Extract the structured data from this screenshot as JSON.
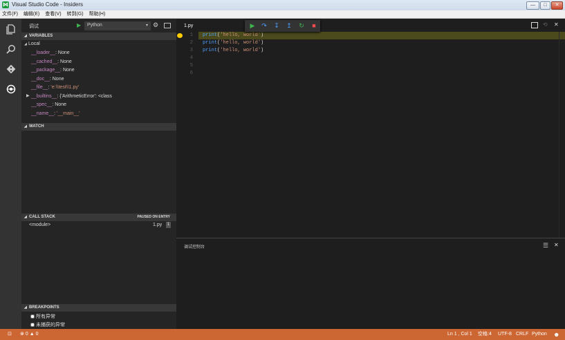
{
  "window": {
    "title": "Visual Studio Code - Insiders",
    "minimize": "—",
    "maximize": "□",
    "close": "✕"
  },
  "menu": [
    "文件(F)",
    "编辑(E)",
    "查看(V)",
    "转到(G)",
    "帮助(H)"
  ],
  "debug": {
    "label": "调试",
    "config": "Python"
  },
  "variables": {
    "header": "VARIABLES",
    "scope": "Local",
    "items": [
      {
        "name": "__loader__",
        "sep": ": ",
        "value": "None"
      },
      {
        "name": "__cached__",
        "sep": ": ",
        "value": "None"
      },
      {
        "name": "__package__",
        "sep": ": ",
        "value": "None"
      },
      {
        "name": "__doc__",
        "sep": ": ",
        "value": "None"
      },
      {
        "name": "__file__",
        "sep": ": ",
        "value": "'e:\\\\test\\\\1.py'"
      },
      {
        "name": "__builtins__",
        "sep": ": ",
        "value": "{'ArithmeticError': <class"
      },
      {
        "name": "__spec__",
        "sep": ": ",
        "value": "None"
      },
      {
        "name": "__name__",
        "sep": ": ",
        "value": "'__main__'"
      }
    ]
  },
  "watch": {
    "header": "WATCH"
  },
  "callstack": {
    "header": "CALL STACK",
    "status": "PAUSED ON ENTRY",
    "frame": "<module>",
    "file": "1.py",
    "line": "1"
  },
  "breakpoints": {
    "header": "BREAKPOINTS",
    "items": [
      "所有异常",
      "未捕获的异常"
    ]
  },
  "editor": {
    "tab": "1.py",
    "line_numbers": [
      "1",
      "2",
      "3",
      "4",
      "5",
      "6"
    ],
    "lines": [
      {
        "fn": "print",
        "open": "(",
        "str": "'hello, world'",
        "close": ")"
      },
      {
        "fn": "print",
        "open": "(",
        "str": "'hello, world'",
        "close": ")"
      },
      {
        "fn": "print",
        "open": "(",
        "str": "'hello, world'",
        "close": ")"
      }
    ]
  },
  "panel": {
    "title": "调试控制台",
    "prompt": ">"
  },
  "status": {
    "errors": "0",
    "warnings": "0",
    "position": "Ln 1 , Col 1",
    "indent": "空格:4",
    "encoding": "UTF-8",
    "eol": "CRLF",
    "language": "Python"
  },
  "colors": {
    "statusbar": "#cc6633",
    "activitybar": "#333333",
    "sidebar": "#252526",
    "editor": "#1e1e1e",
    "current_line": "#4b4a1c"
  }
}
